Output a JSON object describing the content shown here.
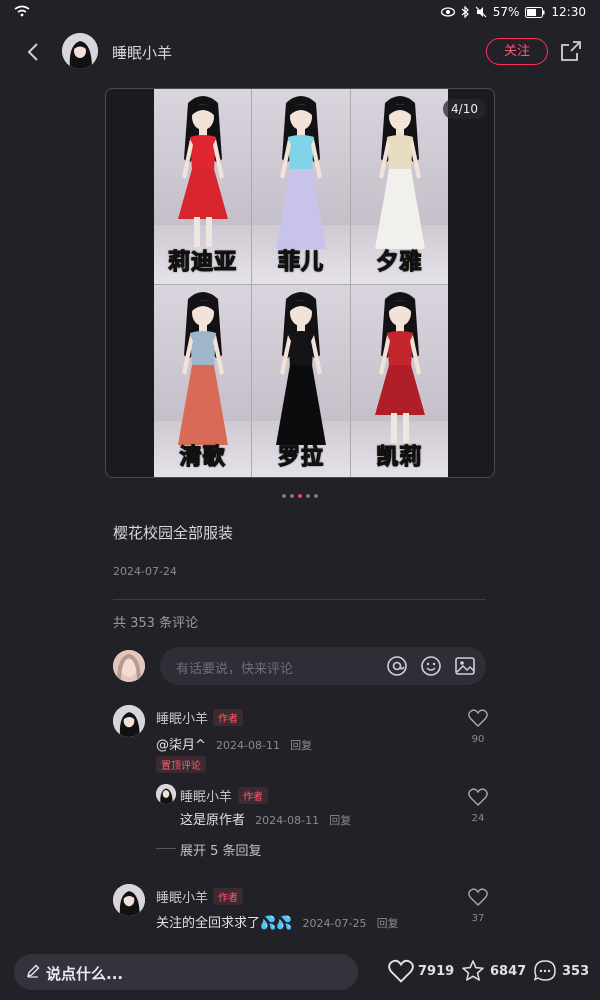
{
  "status_bar": {
    "battery": "57%",
    "time": "12:30"
  },
  "header": {
    "author": "睡眠小羊",
    "follow_label": "关注"
  },
  "post": {
    "page_counter": "4/10",
    "images": [
      {
        "label": "莉迪亚",
        "dress": "#d8242c",
        "top": "#e0262e"
      },
      {
        "label": "菲儿",
        "dress": "#c7c3ea",
        "top": "#7fd4e8"
      },
      {
        "label": "夕雅",
        "dress": "#f2f0ec",
        "top": "#e8dcc0"
      },
      {
        "label": "清歌",
        "dress": "#d96a58",
        "top": "#9fb6cc"
      },
      {
        "label": "罗拉",
        "dress": "#0c0c0e",
        "top": "#141416"
      },
      {
        "label": "凯莉",
        "dress": "#b01e28",
        "top": "#c4262e"
      }
    ],
    "title": "樱花校园全部服装",
    "date": "2024-07-24"
  },
  "comments_section": {
    "count_label": "共 353 条评论",
    "input_placeholder": "有话要说，快来评论"
  },
  "comments": [
    {
      "name": "睡眠小羊",
      "tag": "作者",
      "text": "@柒月^",
      "date": "2024-08-11",
      "reply": "回复",
      "pinned": "置顶评论",
      "likes": "90"
    },
    {
      "name": "睡眠小羊",
      "tag": "作者",
      "text": "这是原作者",
      "date": "2024-08-11",
      "reply": "回复",
      "likes": "24"
    },
    {
      "name": "睡眠小羊",
      "tag": "作者",
      "text": "关注的全回求求了💦💦",
      "date": "2024-07-25",
      "reply": "回复",
      "likes": "37"
    }
  ],
  "expand_label": "展开 5 条回复",
  "bottom_bar": {
    "say_label": "说点什么...",
    "likes": "7919",
    "favorites": "6847",
    "comments": "353"
  },
  "colors": {
    "accent": "#ff2e55",
    "background": "#222128",
    "label_yellow": "#ffe81a"
  }
}
